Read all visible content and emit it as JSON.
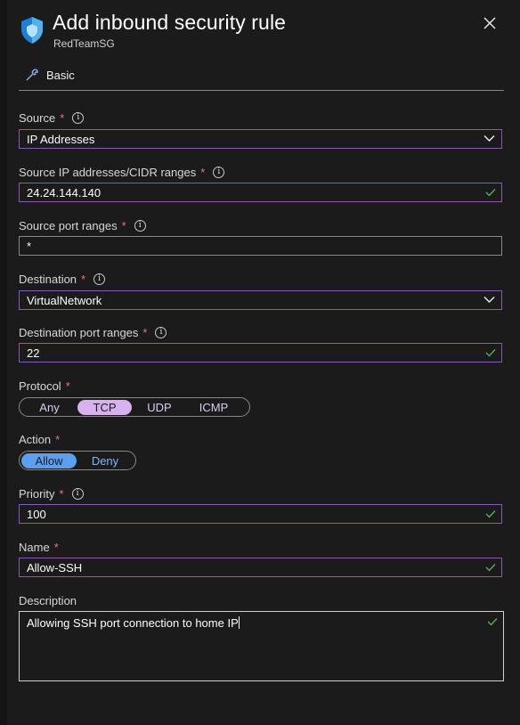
{
  "header": {
    "title": "Add inbound security rule",
    "subtitle": "RedTeamSG"
  },
  "tabs": [
    {
      "label": "Basic"
    }
  ],
  "form": {
    "source": {
      "label": "Source",
      "value": "IP Addresses"
    },
    "source_ip": {
      "label": "Source IP addresses/CIDR ranges",
      "value": "24.24.144.140"
    },
    "source_port": {
      "label": "Source port ranges",
      "value": "*"
    },
    "destination": {
      "label": "Destination",
      "value": "VirtualNetwork"
    },
    "dest_port": {
      "label": "Destination port ranges",
      "value": "22"
    },
    "protocol": {
      "label": "Protocol",
      "options": [
        "Any",
        "TCP",
        "UDP",
        "ICMP"
      ],
      "selected": "TCP"
    },
    "action": {
      "label": "Action",
      "options": [
        "Allow",
        "Deny"
      ],
      "selected": "Allow"
    },
    "priority": {
      "label": "Priority",
      "value": "100"
    },
    "name": {
      "label": "Name",
      "value": "Allow-SSH"
    },
    "description": {
      "label": "Description",
      "value": "Allowing SSH port connection to home IP"
    }
  },
  "required_marker": "*",
  "info_glyph": "i",
  "icons": {
    "header": "shield-icon",
    "tab": "wrench-icon",
    "close": "close-icon",
    "dropdown": "chevron-down-icon",
    "valid": "checkmark-icon",
    "info": "info-icon"
  },
  "colors": {
    "background": "#1b1b1b",
    "focus_border": "#8a5bb6",
    "required": "#f1707b",
    "valid_check": "#5db35d",
    "protocol_selected": "#d7b2ef",
    "action_selected": "#5b9ff0"
  }
}
